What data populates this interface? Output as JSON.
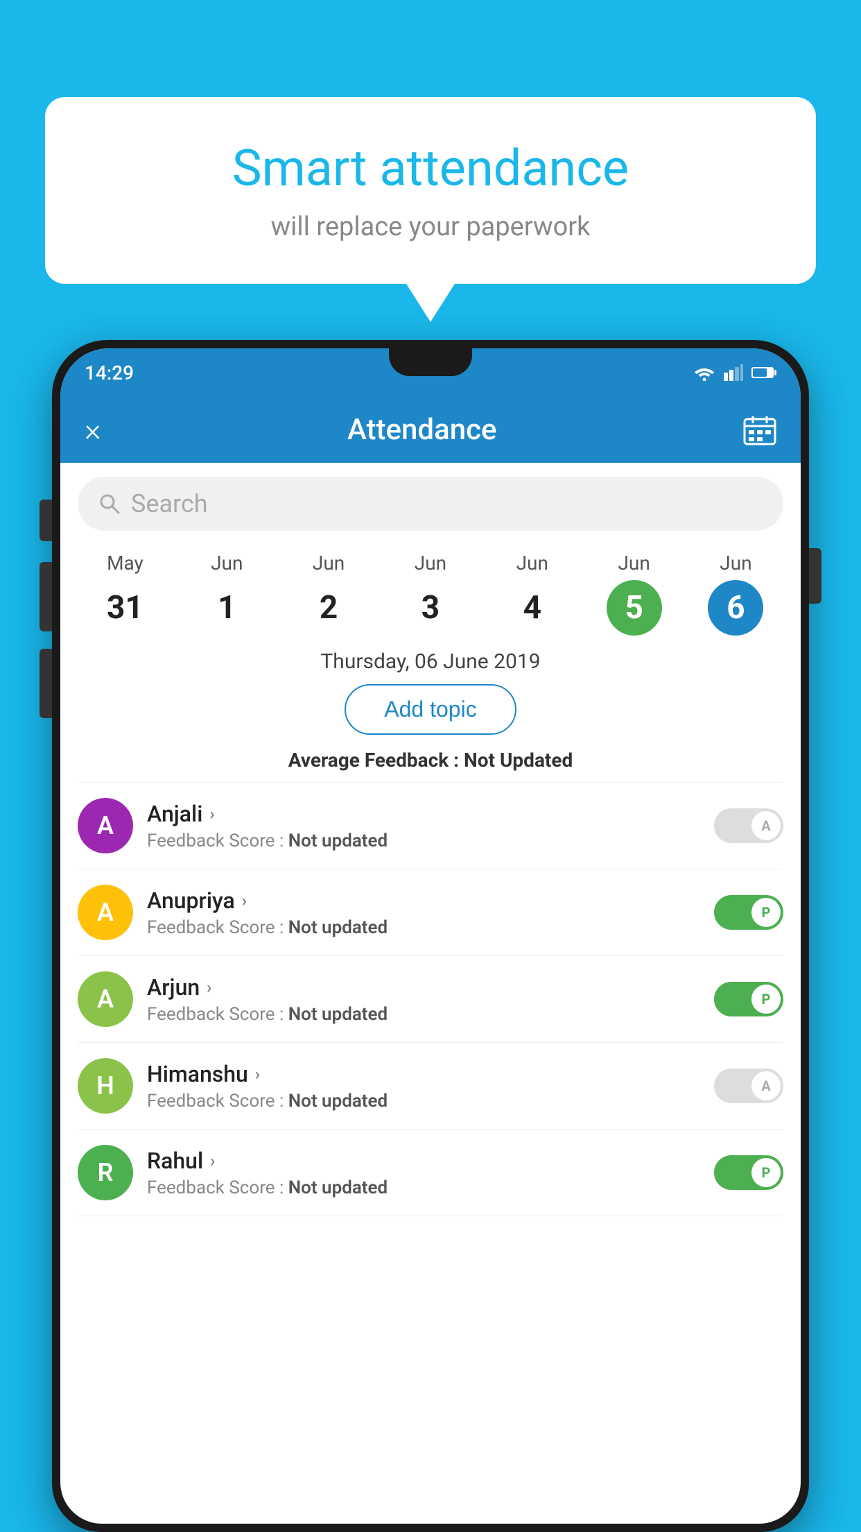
{
  "background_color": "#1ab7ea",
  "speech_bubble": {
    "title": "Smart attendance",
    "subtitle": "will replace your paperwork"
  },
  "status_bar": {
    "time": "14:29"
  },
  "header": {
    "title": "Attendance",
    "close_label": "×",
    "calendar_icon": "calendar"
  },
  "search": {
    "placeholder": "Search"
  },
  "calendar": {
    "days": [
      {
        "month": "May",
        "num": "31",
        "style": "normal"
      },
      {
        "month": "Jun",
        "num": "1",
        "style": "normal"
      },
      {
        "month": "Jun",
        "num": "2",
        "style": "normal"
      },
      {
        "month": "Jun",
        "num": "3",
        "style": "normal"
      },
      {
        "month": "Jun",
        "num": "4",
        "style": "normal"
      },
      {
        "month": "Jun",
        "num": "5",
        "style": "green"
      },
      {
        "month": "Jun",
        "num": "6",
        "style": "blue"
      }
    ]
  },
  "selected_date": "Thursday, 06 June 2019",
  "add_topic_label": "Add topic",
  "avg_feedback_label": "Average Feedback :",
  "avg_feedback_value": "Not Updated",
  "students": [
    {
      "name": "Anjali",
      "avatar_letter": "A",
      "avatar_color": "#9c27b0",
      "feedback_label": "Feedback Score :",
      "feedback_value": "Not updated",
      "toggle": "off",
      "toggle_letter": "A"
    },
    {
      "name": "Anupriya",
      "avatar_letter": "A",
      "avatar_color": "#ffc107",
      "feedback_label": "Feedback Score :",
      "feedback_value": "Not updated",
      "toggle": "on",
      "toggle_letter": "P"
    },
    {
      "name": "Arjun",
      "avatar_letter": "A",
      "avatar_color": "#8bc34a",
      "feedback_label": "Feedback Score :",
      "feedback_value": "Not updated",
      "toggle": "on",
      "toggle_letter": "P"
    },
    {
      "name": "Himanshu",
      "avatar_letter": "H",
      "avatar_color": "#8bc34a",
      "feedback_label": "Feedback Score :",
      "feedback_value": "Not updated",
      "toggle": "off",
      "toggle_letter": "A"
    },
    {
      "name": "Rahul",
      "avatar_letter": "R",
      "avatar_color": "#4caf50",
      "feedback_label": "Feedback Score :",
      "feedback_value": "Not updated",
      "toggle": "on",
      "toggle_letter": "P"
    }
  ]
}
